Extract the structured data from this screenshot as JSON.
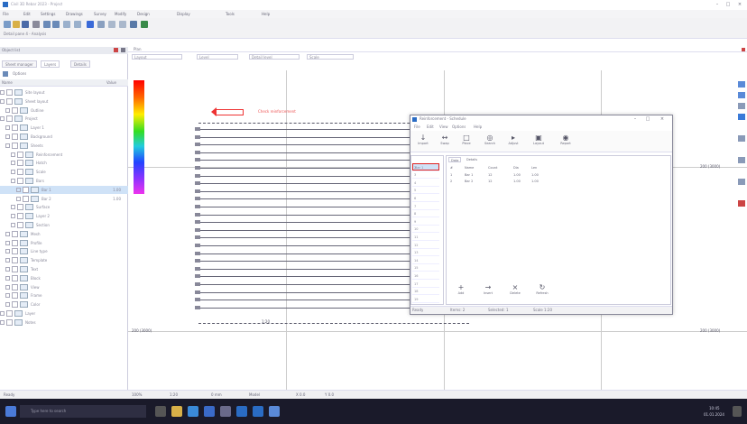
{
  "window": {
    "title": "Civil 3D Rebar 2023 - Project",
    "controls": [
      "–",
      "□",
      "×"
    ]
  },
  "menubar": [
    "File",
    "Edit",
    "Settings",
    "Drawings",
    "Survey",
    "Modify",
    "Design",
    "Display",
    "Tools",
    "Help"
  ],
  "toolbar2_text": "Detail pane 4 - Analysis",
  "left_panel": {
    "header": "Object list",
    "tabs": [
      "Sheet manager",
      "Layers",
      "Details"
    ],
    "tools_label": "Options",
    "col_name": "Name",
    "col_value": "Value",
    "items": [
      {
        "label": "Site layout",
        "value": ""
      },
      {
        "label": "Sheet layout",
        "value": ""
      },
      {
        "label": "Outline",
        "value": ""
      },
      {
        "label": "Project",
        "value": ""
      },
      {
        "label": "Layer 1",
        "value": ""
      },
      {
        "label": "Background",
        "value": ""
      },
      {
        "label": "Sheets",
        "value": ""
      },
      {
        "label": "Reinforcement",
        "value": ""
      },
      {
        "label": "Hatch",
        "value": ""
      },
      {
        "label": "Scale",
        "value": ""
      },
      {
        "label": "Bars",
        "value": ""
      },
      {
        "label": "Bar 1",
        "value": "1.00"
      },
      {
        "label": "Bar 2",
        "value": "1.00"
      },
      {
        "label": "Surface",
        "value": ""
      },
      {
        "label": "Layer 2",
        "value": ""
      },
      {
        "label": "Section",
        "value": ""
      },
      {
        "label": "Mesh",
        "value": ""
      },
      {
        "label": "Profile",
        "value": ""
      },
      {
        "label": "Line type",
        "value": ""
      },
      {
        "label": "Template",
        "value": ""
      },
      {
        "label": "Text",
        "value": ""
      },
      {
        "label": "Block",
        "value": ""
      },
      {
        "label": "View",
        "value": ""
      },
      {
        "label": "Frame",
        "value": ""
      },
      {
        "label": "Color",
        "value": ""
      },
      {
        "label": "Layer",
        "value": ""
      },
      {
        "label": "Notes",
        "value": ""
      }
    ]
  },
  "view": {
    "tab": "Plan",
    "selectors": [
      "Layout",
      "Level",
      "Detail level",
      "Scale"
    ],
    "annotation": "Check reinforcement",
    "scale_label": "1:20",
    "right_labels": [
      "200 (3000)",
      "200 (3000)",
      "200 (3000)"
    ]
  },
  "dialog": {
    "title": "Reinforcement - Schedule",
    "menu": [
      "File",
      "Edit",
      "View",
      "Options",
      "Help"
    ],
    "ribbon": [
      {
        "icon": "↓",
        "label": "Import"
      },
      {
        "icon": "↔",
        "label": "Swap"
      },
      {
        "icon": "□",
        "label": "Place"
      },
      {
        "icon": "◎",
        "label": "Search"
      },
      {
        "icon": "▸",
        "label": "Adjust"
      },
      {
        "icon": "▣",
        "label": "Layout"
      },
      {
        "icon": "◉",
        "label": "Report"
      }
    ],
    "left_list": [
      "Bar 1",
      "2",
      "3",
      "4",
      "5",
      "6",
      "7",
      "8",
      "9",
      "10",
      "11",
      "12",
      "13",
      "14",
      "15",
      "16",
      "17",
      "18",
      "19"
    ],
    "tabs": [
      "Data",
      "Details"
    ],
    "columns": [
      "#",
      "Name",
      "Count",
      "Dia",
      "Len"
    ],
    "rows": [
      [
        "1",
        "Bar 1",
        "12",
        "1.00",
        "1.00"
      ],
      [
        "2",
        "Bar 2",
        "12",
        "1.00",
        "1.00"
      ]
    ],
    "bottom_buttons": [
      {
        "icon": "+",
        "label": "Add"
      },
      {
        "icon": "→",
        "label": "Insert"
      },
      {
        "icon": "×",
        "label": "Delete"
      },
      {
        "icon": "↻",
        "label": "Refresh"
      }
    ],
    "status": [
      "Ready",
      "Items: 2",
      "Selected: 1",
      "Scale 1:20"
    ]
  },
  "statusbar": [
    "Ready",
    "100%",
    "1:20",
    "0 mm",
    "Model",
    "X 0.0",
    "Y 0.0"
  ],
  "taskbar": {
    "search": "Type here to search",
    "time": "10:45",
    "date": "01.01.2024"
  }
}
